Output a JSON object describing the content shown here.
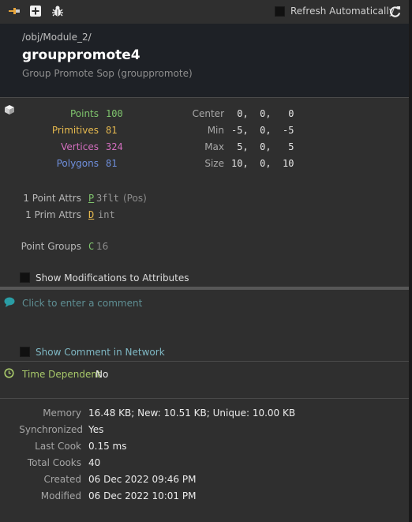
{
  "toolbar": {
    "icons": [
      "pin-icon",
      "add-icon",
      "bug-icon"
    ],
    "refresh_label": "Refresh Automatically"
  },
  "header": {
    "path": "/obj/Module_2/",
    "title": "grouppromote4",
    "subtitle": "Group Promote Sop (grouppromote)"
  },
  "stats": {
    "points_label": "Points",
    "points_value": "100",
    "primitives_label": "Primitives",
    "primitives_value": "81",
    "vertices_label": "Vertices",
    "vertices_value": "324",
    "polygons_label": "Polygons",
    "polygons_value": "81"
  },
  "geometry": {
    "center_label": "Center",
    "center_value": " 0,  0,   0",
    "min_label": "Min",
    "min_value": "-5,  0,  -5",
    "max_label": "Max",
    "max_value": " 5,  0,   5",
    "size_label": "Size",
    "size_value": "10,  0,  10"
  },
  "attributes": {
    "point_attrs_label": "1 Point Attrs",
    "point_code": "P",
    "point_type": "3flt",
    "point_name": "(Pos)",
    "prim_attrs_label": "1 Prim Attrs",
    "prim_code": "D",
    "prim_type": "int",
    "point_groups_label": "Point Groups",
    "point_groups_code": "C",
    "point_groups_count": "16"
  },
  "options": {
    "show_modifications_label": "Show Modifications to Attributes",
    "comment_placeholder": "Click to enter a comment",
    "show_comment_label": "Show Comment in Network"
  },
  "time": {
    "label": "Time Dependent",
    "value": "No"
  },
  "info": {
    "memory_label": "Memory",
    "memory_value": "16.48 KB; New: 10.51 KB; Unique: 10.00 KB",
    "synchronized_label": "Synchronized",
    "synchronized_value": "Yes",
    "last_cook_label": "Last Cook",
    "last_cook_value": "0.15 ms",
    "total_cooks_label": "Total Cooks",
    "total_cooks_value": "40",
    "created_label": "Created",
    "created_value": "06 Dec 2022 09:46 PM",
    "modified_label": "Modified",
    "modified_value": "06 Dec 2022 10:01 PM"
  },
  "colors": {
    "points": "#7fc46d",
    "primitives": "#e6b94f",
    "vertices": "#d36fbf",
    "polygons": "#6f8fdc",
    "comment": "#2a9da5",
    "time_label": "#a8c96a"
  }
}
